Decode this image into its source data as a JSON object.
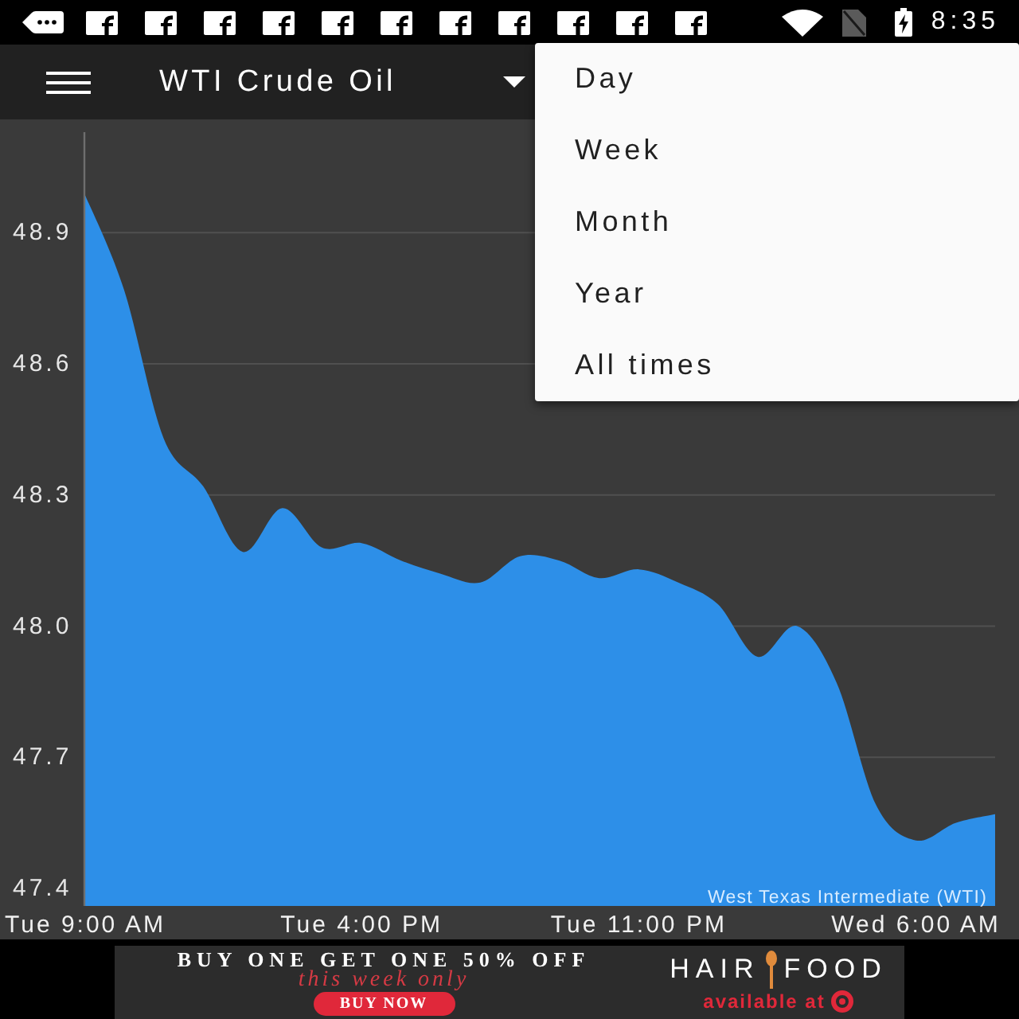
{
  "status_bar": {
    "time": "8:35"
  },
  "toolbar": {
    "title": "WTI Crude Oil"
  },
  "period_menu": {
    "items": [
      "Day",
      "Week",
      "Month",
      "Year",
      "All times"
    ]
  },
  "chart": {
    "chart_data": {
      "type": "area",
      "categories": [
        "Tue 9:00 AM",
        null,
        null,
        null,
        null,
        null,
        null,
        "Tue 4:00 PM",
        null,
        null,
        null,
        null,
        null,
        null,
        "Tue 11:00 PM",
        null,
        null,
        null,
        null,
        null,
        null,
        "Wed 6:00 AM",
        null,
        null
      ],
      "series": [
        {
          "name": "West Texas Intermediate (WTI)",
          "color": "#2d8fe8",
          "values": [
            48.99,
            48.77,
            48.43,
            48.32,
            48.17,
            48.27,
            48.18,
            48.19,
            48.15,
            48.12,
            48.1,
            48.16,
            48.15,
            48.11,
            48.13,
            48.1,
            48.05,
            47.93,
            48.0,
            47.87,
            47.59,
            47.51,
            47.55,
            47.57
          ]
        }
      ],
      "ylim": [
        47.36,
        49.13
      ],
      "yticks": [
        {
          "value": 48.9,
          "label": "48.9"
        },
        {
          "value": 48.6,
          "label": "48.6"
        },
        {
          "value": 48.3,
          "label": "48.3"
        },
        {
          "value": 48.0,
          "label": "48.0"
        },
        {
          "value": 47.7,
          "label": "47.7"
        },
        {
          "value": 47.4,
          "label": "47.4"
        }
      ],
      "grid": true
    }
  },
  "ad_banner": {
    "headline": "BUY ONE GET ONE 50% OFF",
    "tagline": "this week only",
    "button": "BUY NOW",
    "brand_words": [
      "HAIR",
      "FOOD"
    ],
    "availability": "available at"
  }
}
